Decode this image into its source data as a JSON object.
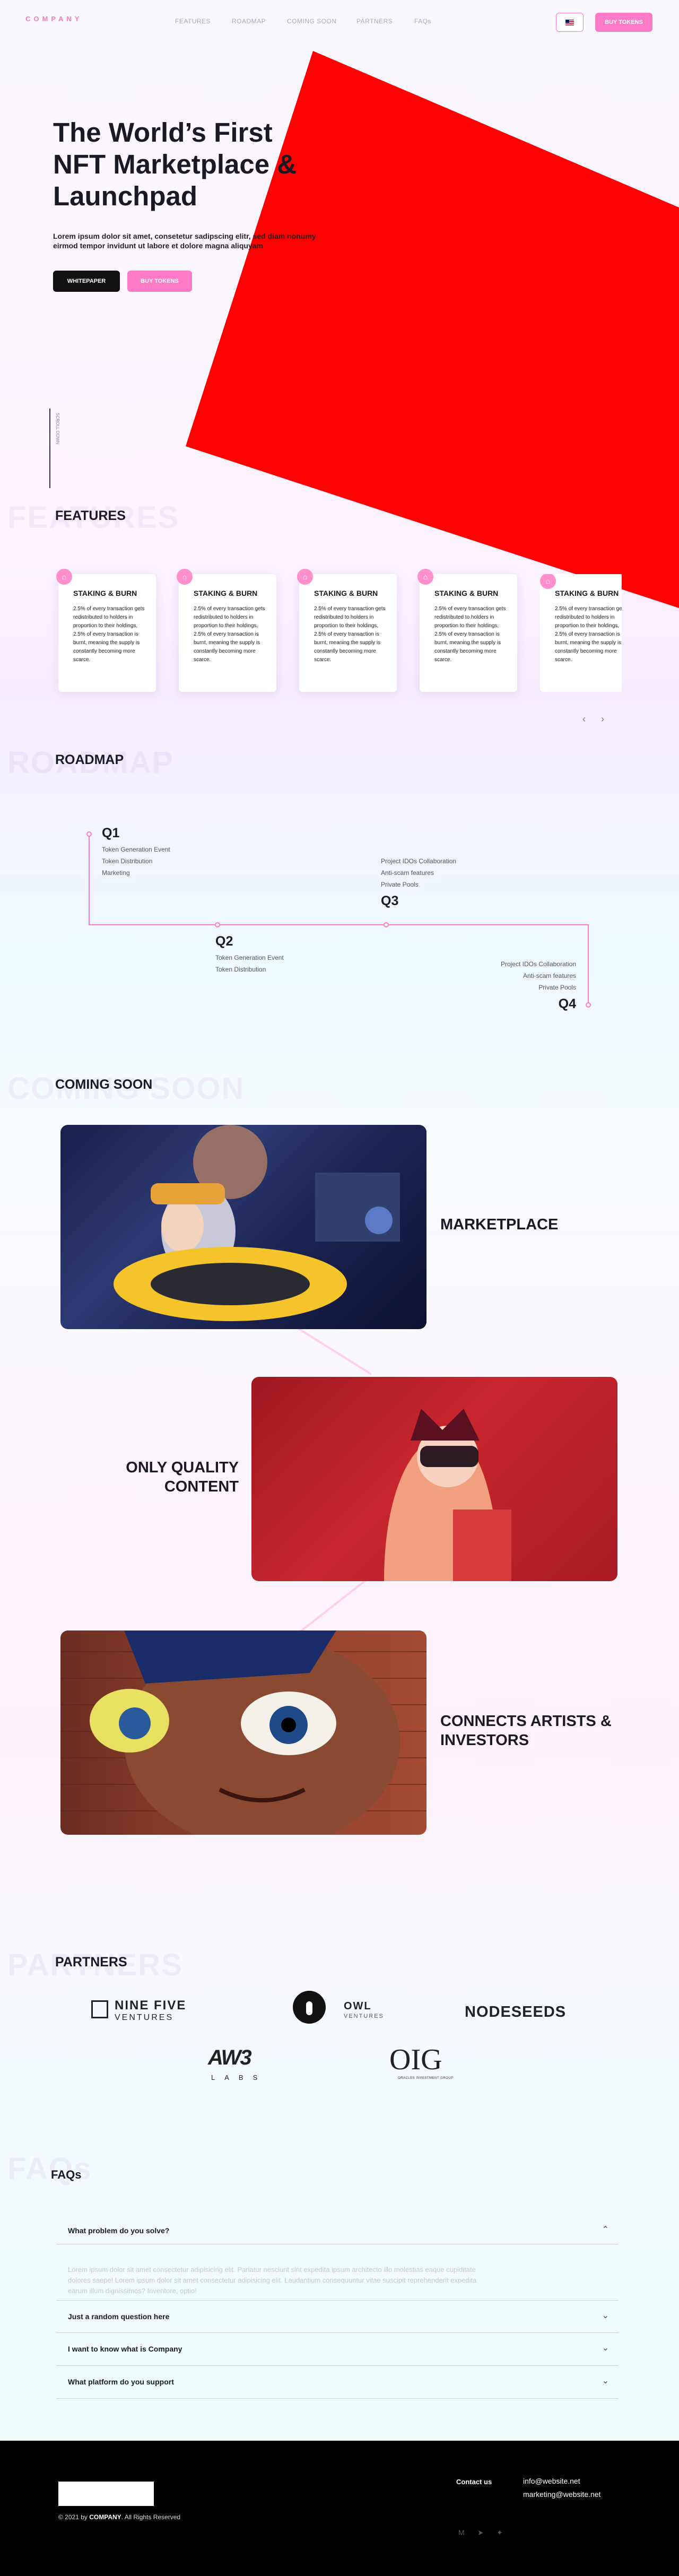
{
  "header": {
    "logo": "COMPANY",
    "nav": [
      "FEATURES",
      "ROADMAP",
      "COMING SOON",
      "PARTNERS",
      "FAQs"
    ],
    "language_icon": "uk-flag-icon",
    "buy_label": "BUY TOKENS"
  },
  "hero": {
    "title_line1": "The World’s First",
    "title_line2": "NFT Marketplace &",
    "title_line3": "Launchpad",
    "subtitle_line1": "Lorem ipsum dolor sit amet, consetetur sadipscing elitr, sed diam nonumy",
    "subtitle_line2": "eirmod tempor invidunt ut labore et dolore magna aliquyam",
    "whitepaper_label": "WHITEPAPER",
    "buy_label": "BUY TOKENS",
    "scroll_label": "SCROLL DOWN",
    "accent_color": "#ff0000"
  },
  "features": {
    "bg_title": "FEATURES",
    "title": "FEATURES",
    "cards": [
      {
        "title": "STAKING & BURN",
        "text": "2.5% of every transaction gets redistributed to holders in proportion to their holdings, 2.5% of every transaction is burnt, meaning the supply is constantly becoming more scarce."
      },
      {
        "title": "STAKING & BURN",
        "text": "2.5% of every transaction gets redistributed to holders in proportion to their holdings, 2.5% of every transaction is burnt, meaning the supply is constantly becoming more scarce."
      },
      {
        "title": "STAKING & BURN",
        "text": "2.5% of every transaction gets redistributed to holders in proportion to their holdings, 2.5% of every transaction is burnt, meaning the supply is constantly becoming more scarce."
      },
      {
        "title": "STAKING & BURN",
        "text": "2.5% of every transaction gets redistributed to holders in proportion to their holdings, 2.5% of every transaction is burnt, meaning the supply is constantly becoming more scarce."
      },
      {
        "title": "STAKING & BURN",
        "text": "2.5% of every transaction gets redistributed to holders in proportion to their holdings, 2.5% of every transaction is burnt, meaning the supply is constantly becoming more scarce."
      }
    ],
    "prev_icon": "chevron-left-icon",
    "next_icon": "chevron-right-icon"
  },
  "roadmap": {
    "bg_title": "ROADMAP",
    "title": "ROADMAP",
    "phases": [
      {
        "label": "Q1",
        "items": [
          "Token Generation Event",
          "Token Distribution",
          "Marketing"
        ]
      },
      {
        "label": "Q2",
        "items": [
          "Token Generation Event",
          "Token Distribution"
        ]
      },
      {
        "label": "Q3",
        "items": [
          "Project IDOs Collaboration",
          "Anti-scam features",
          "Private Pools"
        ]
      },
      {
        "label": "Q4",
        "items": [
          "Project IDOs Collaboration",
          "Anti-scam features",
          "Private Pools"
        ]
      }
    ]
  },
  "coming_soon": {
    "bg_title": "COMING SOON",
    "title": "COMING SOON",
    "items": [
      {
        "label_line1": "MARKETPLACE",
        "label_line2": ""
      },
      {
        "label_line1": "ONLY QUALITY",
        "label_line2": "CONTENT"
      },
      {
        "label_line1": "CONNECTS ARTISTS &",
        "label_line2": "INVESTORS"
      }
    ]
  },
  "partners": {
    "bg_title": "PARTNERS",
    "title": "PARTNERS",
    "logos": [
      {
        "name_top": "NINE FIVE",
        "name_bottom": "VENTURES"
      },
      {
        "name_top": "OWL",
        "name_bottom": "VENTURES"
      },
      {
        "name_top": "NODESEEDS",
        "name_bottom": ""
      },
      {
        "name_top": "AW3",
        "name_bottom": "LABS"
      },
      {
        "name_top": "OIG",
        "name_bottom": "ORACLES INVESTMENT GROUP"
      }
    ]
  },
  "faq": {
    "bg_title": "FAQs",
    "title": "FAQs",
    "items": [
      {
        "question": "What problem do you solve?",
        "open": true
      },
      {
        "question": "Just a random question here",
        "open": false
      },
      {
        "question": "I want to know what is Company",
        "open": false
      },
      {
        "question": "What platform do you support",
        "open": false
      }
    ],
    "answer_line1": "Lorem ipsum dolor sit amet consectetur adipisicing elit. Pariatur nesciunt sint expedita ipsum architecto illo molestias eaque cupiditate",
    "answer_line2": "dolores saepe! Lorem ipsum dolor sit amet consectetur adipisicing elit. Laudantium consequuntur vitae suscipit reprehenderit expedita",
    "answer_line3": "earum illum dignissimos? Inventore, optio!"
  },
  "footer": {
    "copyright_prefix": "© 2021 by",
    "company": "COMPANY",
    "copyright_suffix": ". All Rights Reserved",
    "contact_label": "Contact us",
    "emails": [
      "info@website.net",
      "marketing@website.net"
    ],
    "social_icons": [
      "medium-icon",
      "telegram-icon",
      "twitter-icon"
    ]
  }
}
